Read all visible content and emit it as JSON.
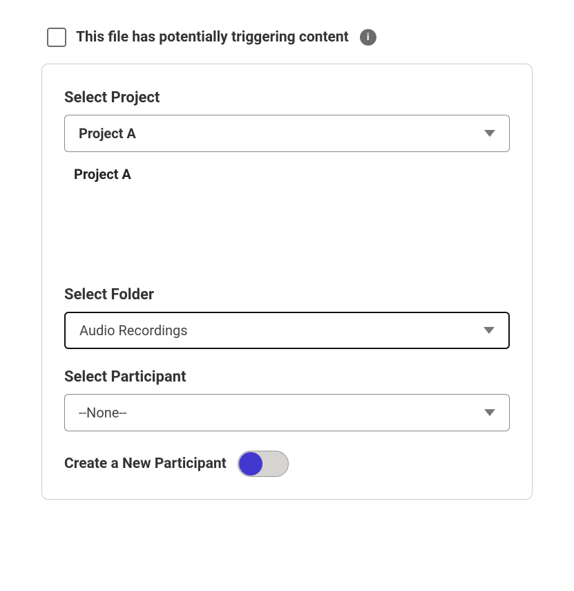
{
  "trigger": {
    "label": "This file has potentially triggering content",
    "info_glyph": "i"
  },
  "project": {
    "label": "Select Project",
    "selected": "Project A",
    "options": [
      "Project A"
    ]
  },
  "folder": {
    "label": "Select Folder",
    "selected": "Audio Recordings"
  },
  "participant": {
    "label": "Select Participant",
    "selected": "--None--"
  },
  "create_participant": {
    "label": "Create a New Participant"
  }
}
